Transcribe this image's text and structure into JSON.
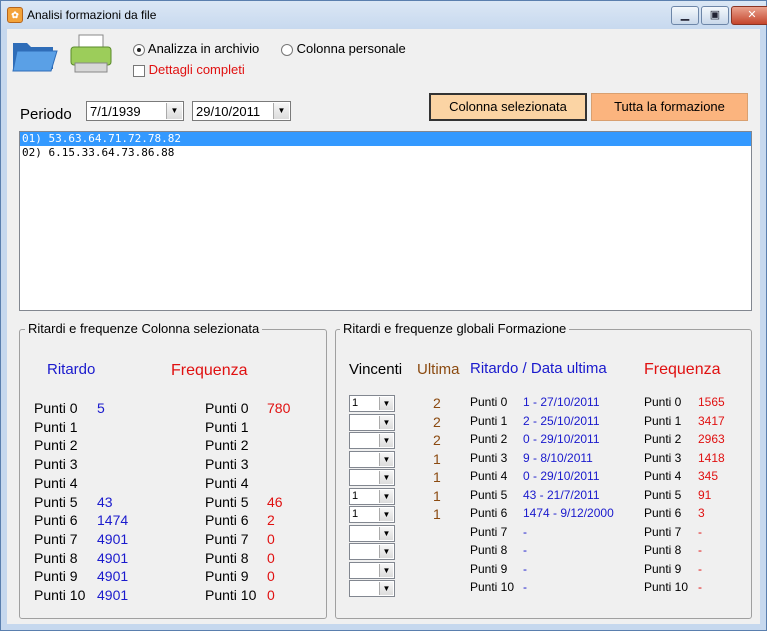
{
  "window": {
    "title": "Analisi formazioni da file"
  },
  "toolbar": {
    "open_icon": "folder-open-icon",
    "print_icon": "printer-icon"
  },
  "options": {
    "radio_archivio": "Analizza in archivio",
    "radio_personale": "Colonna personale",
    "check_dettagli": "Dettagli completi",
    "selected": "archivio"
  },
  "period": {
    "label": "Periodo",
    "from": "7/1/1939",
    "to": "29/10/2011"
  },
  "buttons": {
    "colonna": "Colonna selezionata",
    "tutta": "Tutta la formazione"
  },
  "list": {
    "rows": [
      "01) 53.63.64.71.72.78.82",
      "02) 6.15.33.64.73.86.88"
    ]
  },
  "left_group": {
    "title": "Ritardi e frequenze Colonna selezionata",
    "ritardo_header": "Ritardo",
    "frequenza_header": "Frequenza",
    "rows": [
      {
        "label": "Punti 0",
        "ritardo": "5",
        "freq_label": "Punti 0",
        "frequenza": "780"
      },
      {
        "label": "Punti 1",
        "ritardo": "",
        "freq_label": "Punti 1",
        "frequenza": ""
      },
      {
        "label": "Punti 2",
        "ritardo": "",
        "freq_label": "Punti 2",
        "frequenza": ""
      },
      {
        "label": "Punti 3",
        "ritardo": "",
        "freq_label": "Punti 3",
        "frequenza": ""
      },
      {
        "label": "Punti 4",
        "ritardo": "",
        "freq_label": "Punti 4",
        "frequenza": ""
      },
      {
        "label": "Punti 5",
        "ritardo": "43",
        "freq_label": "Punti 5",
        "frequenza": "46"
      },
      {
        "label": "Punti 6",
        "ritardo": "1474",
        "freq_label": "Punti 6",
        "frequenza": "2"
      },
      {
        "label": "Punti 7",
        "ritardo": "4901",
        "freq_label": "Punti 7",
        "frequenza": "0"
      },
      {
        "label": "Punti 8",
        "ritardo": "4901",
        "freq_label": "Punti 8",
        "frequenza": "0"
      },
      {
        "label": "Punti 9",
        "ritardo": "4901",
        "freq_label": "Punti 9",
        "frequenza": "0"
      },
      {
        "label": "Punti 10",
        "ritardo": "4901",
        "freq_label": "Punti 10",
        "frequenza": "0"
      }
    ]
  },
  "right_group": {
    "title": "Ritardi e frequenze globali Formazione",
    "vincenti_header": "Vincenti",
    "ultima_header": "Ultima",
    "ritardo_header": "Ritardo / Data ultima",
    "frequenza_header": "Frequenza",
    "rows": [
      {
        "combo": "1",
        "ultima": "2",
        "label": "Punti 0",
        "ritardo": "1 - 27/10/2011",
        "freq_label": "Punti 0",
        "frequenza": "1565"
      },
      {
        "combo": "",
        "ultima": "2",
        "label": "Punti 1",
        "ritardo": "2 - 25/10/2011",
        "freq_label": "Punti 1",
        "frequenza": "3417"
      },
      {
        "combo": "",
        "ultima": "2",
        "label": "Punti 2",
        "ritardo": "0 - 29/10/2011",
        "freq_label": "Punti 2",
        "frequenza": "2963"
      },
      {
        "combo": "",
        "ultima": "1",
        "label": "Punti 3",
        "ritardo": "9 - 8/10/2011",
        "freq_label": "Punti 3",
        "frequenza": "1418"
      },
      {
        "combo": "",
        "ultima": "1",
        "label": "Punti 4",
        "ritardo": "0 - 29/10/2011",
        "freq_label": "Punti 4",
        "frequenza": "345"
      },
      {
        "combo": "1",
        "ultima": "1",
        "label": "Punti 5",
        "ritardo": "43 - 21/7/2011",
        "freq_label": "Punti 5",
        "frequenza": "91"
      },
      {
        "combo": "1",
        "ultima": "1",
        "label": "Punti 6",
        "ritardo": "1474 - 9/12/2000",
        "freq_label": "Punti 6",
        "frequenza": "3"
      },
      {
        "combo": "",
        "ultima": "",
        "label": "Punti 7",
        "ritardo": "-",
        "freq_label": "Punti 7",
        "frequenza": "-"
      },
      {
        "combo": "",
        "ultima": "",
        "label": "Punti 8",
        "ritardo": "-",
        "freq_label": "Punti 8",
        "frequenza": "-"
      },
      {
        "combo": "",
        "ultima": "",
        "label": "Punti 9",
        "ritardo": "-",
        "freq_label": "Punti 9",
        "frequenza": "-"
      },
      {
        "combo": "",
        "ultima": "",
        "label": "Punti 10",
        "ritardo": "-",
        "freq_label": "Punti 10",
        "frequenza": "-"
      }
    ]
  }
}
